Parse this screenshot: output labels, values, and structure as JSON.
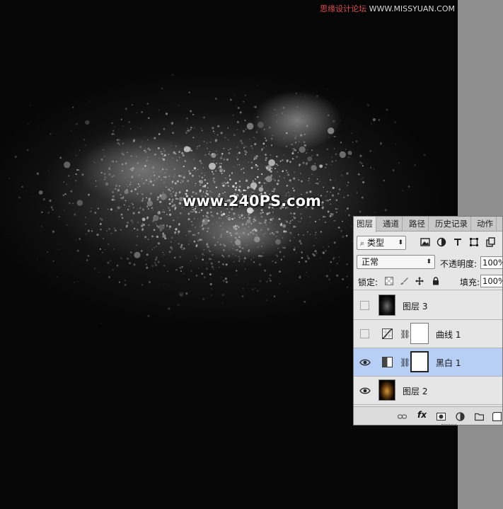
{
  "watermark": {
    "text": "www.240PS.com"
  },
  "site_mark": {
    "text_main": "思缘设计论坛",
    "text_url": "WWW.MISSYUAN.COM"
  },
  "panel": {
    "tabs": [
      {
        "label": "图层",
        "active": true
      },
      {
        "label": "通道",
        "active": false
      },
      {
        "label": "路径",
        "active": false
      },
      {
        "label": "历史记录",
        "active": false
      },
      {
        "label": "动作",
        "active": false
      }
    ],
    "filter": {
      "label": "类型",
      "icons": [
        "image-filter-icon",
        "adjustment-filter-icon",
        "type-filter-icon",
        "shape-filter-icon",
        "smart-object-filter-icon"
      ]
    },
    "blend_mode": "正常",
    "opacity_label": "不透明度:",
    "opacity_value": "100%",
    "lock_label": "锁定:",
    "fill_label": "填充:",
    "fill_value": "100%",
    "layers": [
      {
        "name": "图层 3",
        "visible": false,
        "selected": false,
        "kind": "pixel"
      },
      {
        "name": "曲线 1",
        "visible": false,
        "selected": false,
        "kind": "curves-adjustment"
      },
      {
        "name": "黑白 1",
        "visible": true,
        "selected": true,
        "kind": "black-white-adjustment"
      },
      {
        "name": "图层 2",
        "visible": true,
        "selected": false,
        "kind": "pixel"
      }
    ],
    "bottom_icons": [
      "link-icon",
      "fx-icon",
      "add-mask-icon",
      "new-adjustment-icon",
      "new-group-icon",
      "new-layer-icon"
    ],
    "bottom_fx_label": "fx"
  },
  "colors": {
    "selected_layer": "#b8cff5",
    "panel_bg": "#e6e6e6",
    "canvas_bg": "#060606"
  }
}
